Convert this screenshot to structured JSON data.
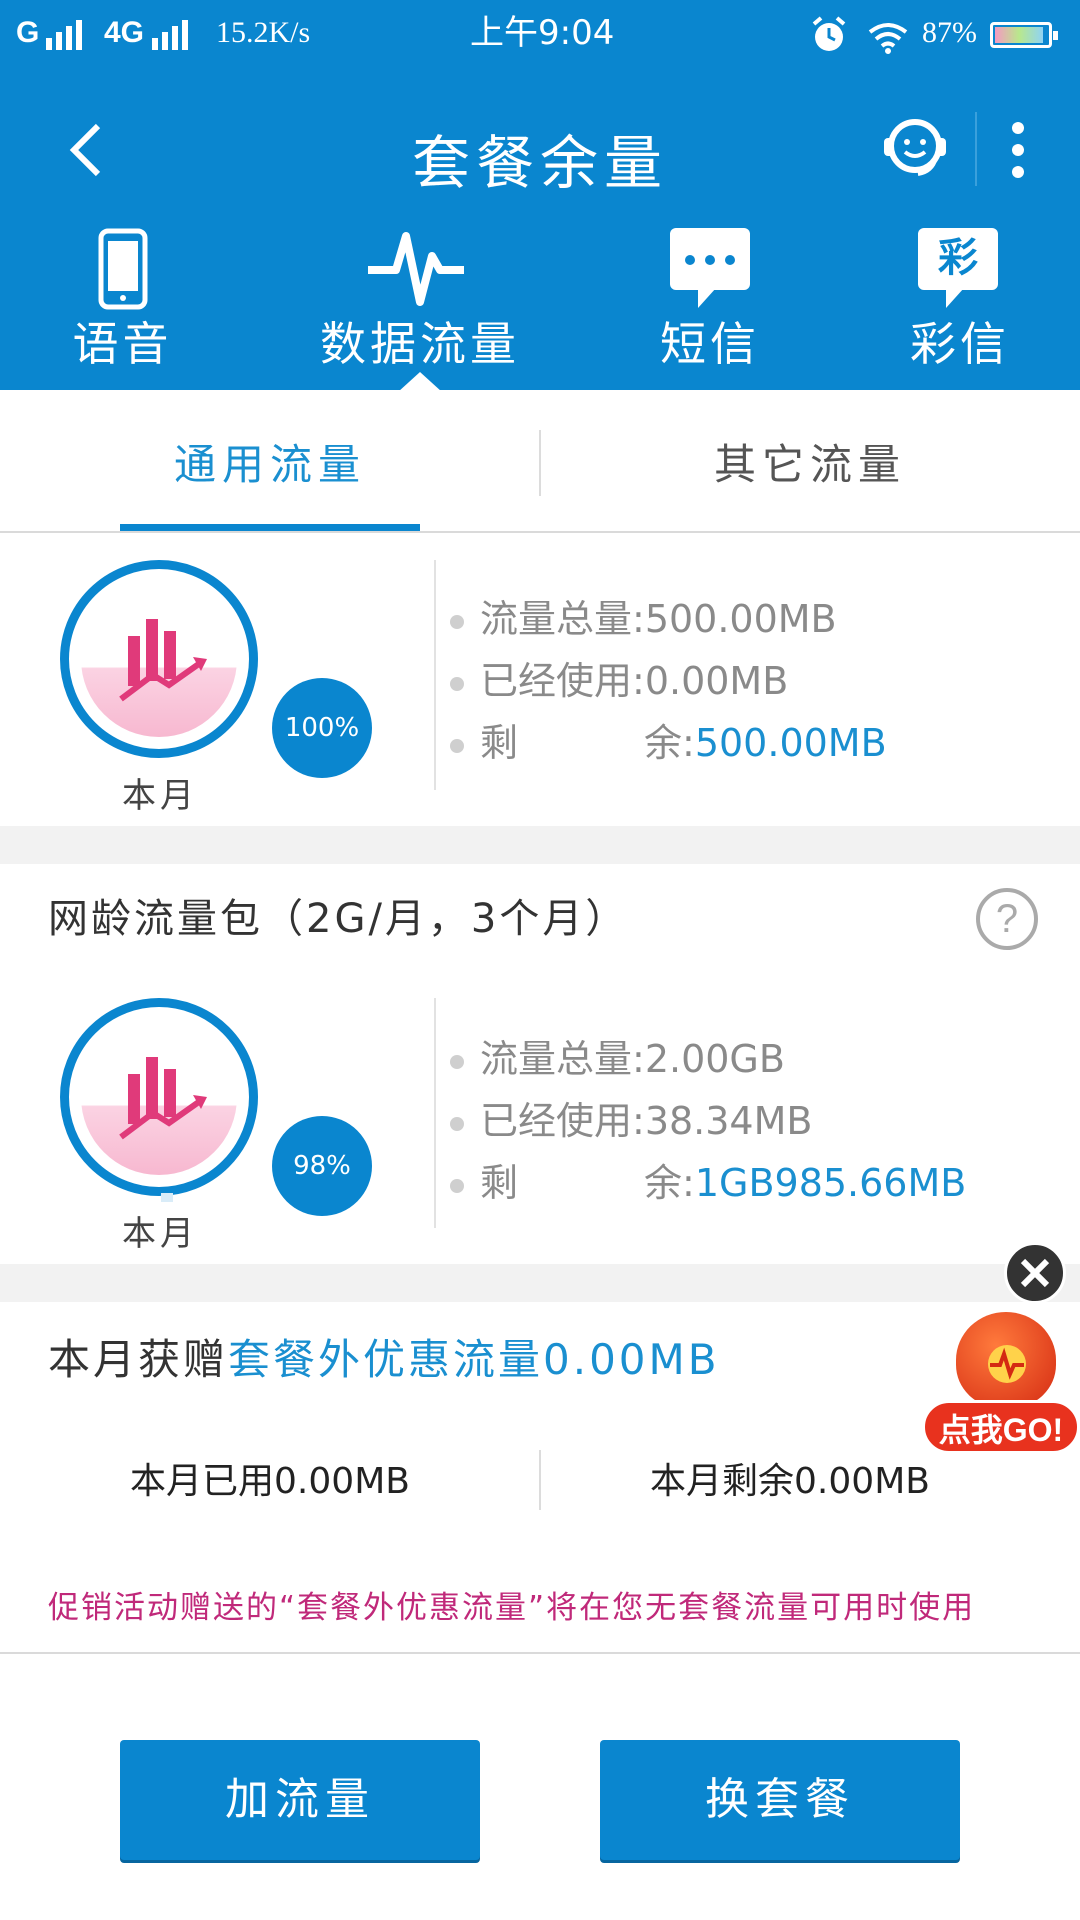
{
  "status_bar": {
    "signal1": "G",
    "signal2": "4G",
    "speed": "15.2K/s",
    "time": "上午9:04",
    "battery": "87%",
    "alarm_icon": "alarm-clock-icon",
    "wifi_icon": "wifi-icon"
  },
  "nav": {
    "title": "套餐余量",
    "back_icon": "chevron-left-icon",
    "service_icon": "customer-service-icon",
    "more_icon": "more-vertical-icon"
  },
  "categories": [
    {
      "label": "语音",
      "icon": "phone-icon"
    },
    {
      "label": "数据流量",
      "icon": "pulse-icon"
    },
    {
      "label": "短信",
      "icon": "message-icon"
    },
    {
      "label": "彩信",
      "icon": "mms-icon",
      "icon_text": "彩"
    }
  ],
  "sub_tabs": [
    {
      "label": "通用流量",
      "active": true
    },
    {
      "label": "其它流量",
      "active": false
    }
  ],
  "plans": [
    {
      "title": "",
      "percent": "100%",
      "percent_value": 100,
      "month_label": "本月",
      "total_label": "流量总量:",
      "total_value": "500.00MB",
      "used_label": "已经使用:",
      "used_value": "0.00MB",
      "remain_label1": "剩",
      "remain_label2": "余:",
      "remain_value": "500.00MB"
    },
    {
      "title": "网龄流量包（2G/月，3个月）",
      "percent": "98%",
      "percent_value": 98,
      "month_label": "本月",
      "total_label": "流量总量:",
      "total_value": "2.00GB",
      "used_label": "已经使用:",
      "used_value": "38.34MB",
      "remain_label1": "剩",
      "remain_label2": "余:",
      "remain_value": "1GB985.66MB"
    }
  ],
  "bonus": {
    "prefix": "本月获赠",
    "highlight": "套餐外优惠流量0.00MB",
    "used": "本月已用0.00MB",
    "remaining": "本月剩余0.00MB",
    "note": "促销活动赠送的“套餐外优惠流量”将在您无套餐流量可用时使用"
  },
  "promo": {
    "label": "点我GO!",
    "close_icon": "close-icon"
  },
  "buttons": {
    "add_traffic": "加流量",
    "change_plan": "换套餐"
  },
  "colors": {
    "primary": "#0a86cf",
    "accent_text": "#1a8fd0",
    "note": "#c0297a",
    "promo": "#e8321e"
  }
}
